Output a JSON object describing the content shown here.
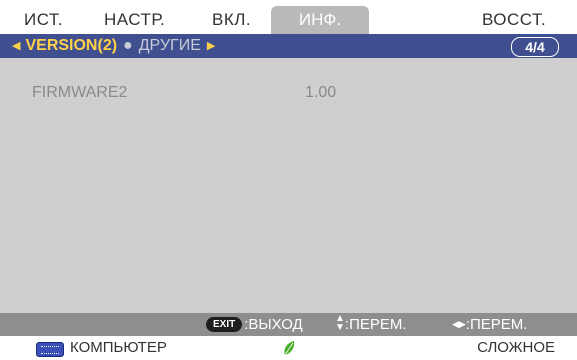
{
  "tabs": {
    "items": [
      {
        "label": "ИСТ."
      },
      {
        "label": "НАСТР."
      },
      {
        "label": "ВКЛ."
      },
      {
        "label": "ИНФ."
      },
      {
        "label": "ВОССТ."
      }
    ],
    "active_index": 3
  },
  "subbar": {
    "current": "VERSION(2)",
    "other": "ДРУГИЕ",
    "page": "4/4"
  },
  "content": {
    "row_label": "FIRMWARE2",
    "row_value": "1.00"
  },
  "help": {
    "exit_badge": "EXIT",
    "exit_text": ":ВЫХОД",
    "updown_text": ":ПЕРЕМ.",
    "leftright_text": ":ПЕРЕМ."
  },
  "status": {
    "source_icon": "computer-input-icon",
    "source_label": "КОМПЬЮТЕР",
    "eco_icon": "eco-leaf-icon",
    "mode_label": "СЛОЖНОЕ"
  },
  "colors": {
    "accent_bar": "#3f4f8f",
    "active_tab": "#b9b9b9",
    "highlight_text": "#ffd14a",
    "content_bg": "#cfcfcf",
    "help_bar": "#8e8e8e",
    "eco_leaf": "#4caf2a"
  }
}
